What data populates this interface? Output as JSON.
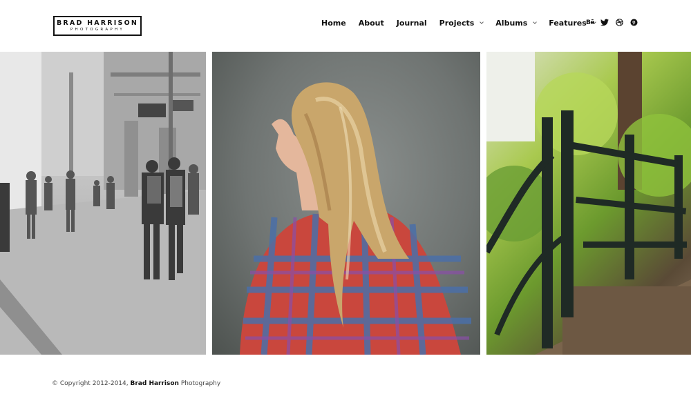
{
  "header": {
    "logo": {
      "name": "BRAD HARRISON",
      "subtitle": "PHOTOGRAPHY"
    },
    "nav": [
      {
        "label": "Home",
        "has_dropdown": false
      },
      {
        "label": "About",
        "has_dropdown": false
      },
      {
        "label": "Journal",
        "has_dropdown": false
      },
      {
        "label": "Projects",
        "has_dropdown": true
      },
      {
        "label": "Albums",
        "has_dropdown": true
      },
      {
        "label": "Features",
        "has_dropdown": true
      }
    ],
    "social": [
      {
        "icon": "behance-icon",
        "text": "Bē"
      },
      {
        "icon": "twitter-icon"
      },
      {
        "icon": "dribbble-icon"
      },
      {
        "icon": "pinterest-icon"
      }
    ]
  },
  "gallery": {
    "photos": [
      {
        "icon": "street-photo"
      },
      {
        "icon": "portrait-photo"
      },
      {
        "icon": "railing-photo"
      }
    ]
  },
  "footer": {
    "prefix": "© Copyright 2012-2014,",
    "name": "Brad Harrison",
    "suffix": "Photography"
  },
  "colors": {
    "text": "#111111",
    "background": "#ffffff",
    "footer_text": "#444444"
  }
}
